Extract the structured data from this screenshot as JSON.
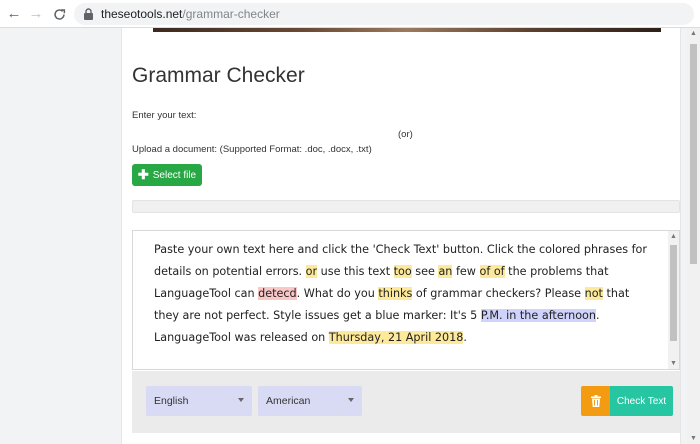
{
  "browser": {
    "url_host": "theseotools.net",
    "url_path": "/grammar-checker",
    "icons": [
      "back-icon",
      "forward-icon",
      "reload-icon",
      "lock-icon"
    ]
  },
  "page": {
    "title": "Grammar Checker",
    "enter_label": "Enter your text:",
    "or_label": "(or)",
    "upload_label": "Upload a document: (Supported Format: .doc, .docx, .txt)",
    "select_file_label": "Select file",
    "upload_progress": 0
  },
  "editor": {
    "segments": [
      {
        "text": "Paste your own text here and click the 'Check Text' button. Click the colored phrases for details on potential errors. ",
        "hl": ""
      },
      {
        "text": "or",
        "hl": "yellow"
      },
      {
        "text": " use this text ",
        "hl": ""
      },
      {
        "text": "too",
        "hl": "yellow"
      },
      {
        "text": " see ",
        "hl": ""
      },
      {
        "text": "an",
        "hl": "yellow"
      },
      {
        "text": " few ",
        "hl": ""
      },
      {
        "text": "of of",
        "hl": "yellow"
      },
      {
        "text": " the problems that LanguageTool can ",
        "hl": ""
      },
      {
        "text": "detecd",
        "hl": "red"
      },
      {
        "text": ". What do you ",
        "hl": ""
      },
      {
        "text": "thinks",
        "hl": "yellow"
      },
      {
        "text": " of grammar checkers? Please ",
        "hl": ""
      },
      {
        "text": "not",
        "hl": "yellow"
      },
      {
        "text": " that they are not perfect. Style issues get a blue marker: It's 5 ",
        "hl": ""
      },
      {
        "text": "P.M. in the afternoon",
        "hl": "blue"
      },
      {
        "text": ". LanguageTool was released on ",
        "hl": ""
      },
      {
        "text": "Thursday, 21 April 2018",
        "hl": "yellow"
      },
      {
        "text": ".",
        "hl": ""
      }
    ]
  },
  "toolbar": {
    "language_selected": "English",
    "variant_selected": "American",
    "check_label": "Check Text"
  },
  "colors": {
    "select_file_bg": "#28a745",
    "trash_bg": "#f39c12",
    "check_bg": "#26c6a2",
    "highlight_yellow": "#fde99a",
    "highlight_red": "#fac7c7",
    "highlight_blue": "#cfd3fb"
  }
}
